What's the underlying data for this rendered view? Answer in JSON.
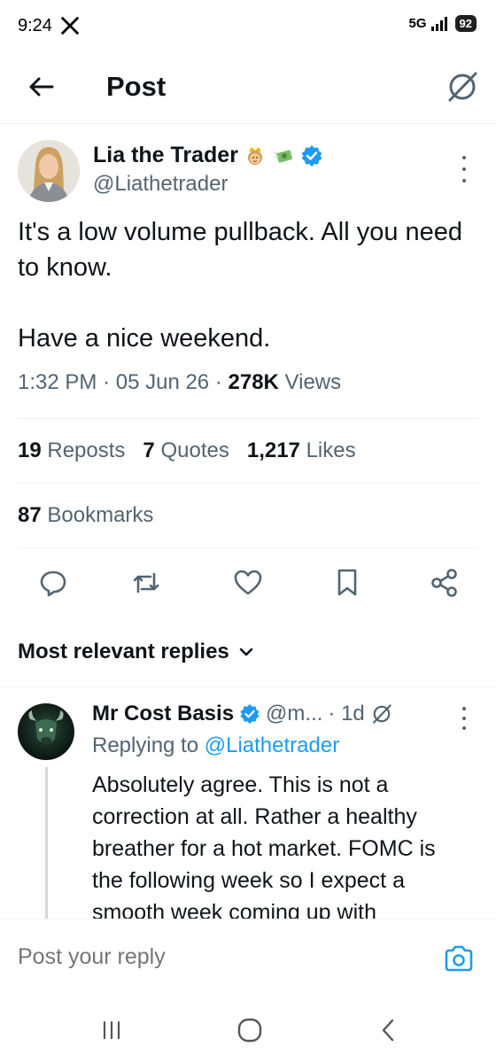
{
  "status_bar": {
    "time": "9:24",
    "network": "5G",
    "battery": "92"
  },
  "header": {
    "title": "Post"
  },
  "tweet": {
    "author_name": "Lia the Trader",
    "handle": "@Liathetrader",
    "text": "It's a low volume pullback. All you need to know.\n\nHave a nice weekend.",
    "time": "1:32 PM",
    "date": "05 Jun 26",
    "views_count": "278K",
    "views_label": "Views",
    "reposts_count": "19",
    "reposts_label": "Reposts",
    "quotes_count": "7",
    "quotes_label": "Quotes",
    "likes_count": "1,217",
    "likes_label": "Likes",
    "bookmarks_count": "87",
    "bookmarks_label": "Bookmarks"
  },
  "replies": {
    "sort_label": "Most relevant replies",
    "items": [
      {
        "name": "Mr Cost Basis",
        "handle": "@m...",
        "age": "· 1d",
        "replying_prefix": "Replying to",
        "replying_to": "@Liathetrader",
        "text": "Absolutely agree. This is not a correction at all. Rather a healthy breather for a hot market. FOMC is the following week so I expect a smooth week coming up with"
      }
    ]
  },
  "reply_bar": {
    "placeholder": "Post your reply"
  },
  "colors": {
    "accent": "#1d9bf0",
    "text": "#0f1419",
    "muted": "#536471",
    "divider": "#eff3f4"
  }
}
